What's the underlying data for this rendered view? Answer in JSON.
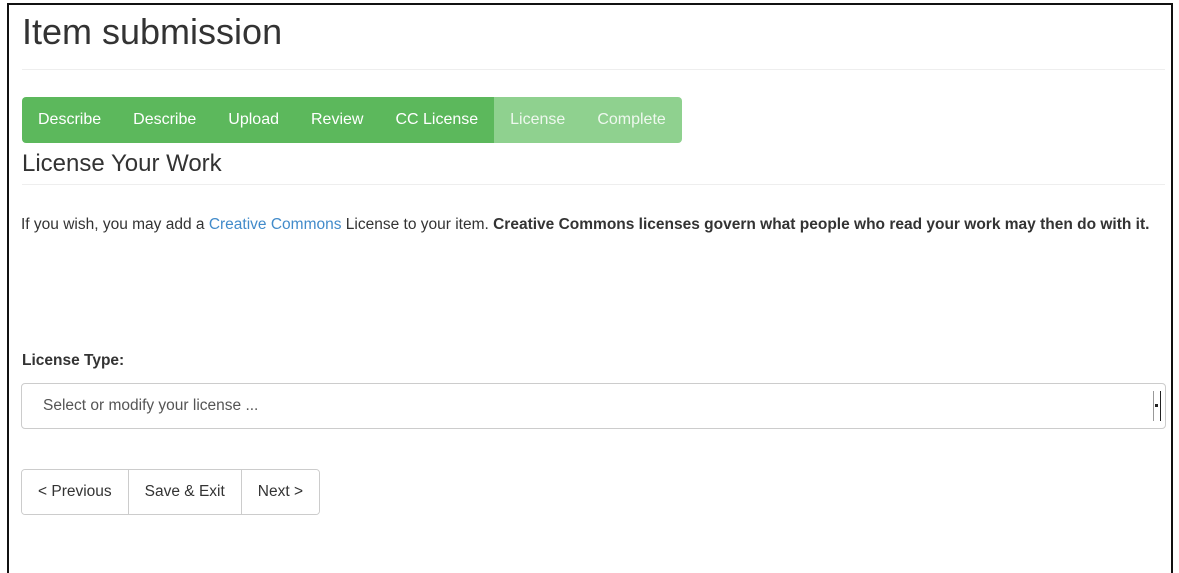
{
  "page": {
    "title": "Item submission"
  },
  "progress": {
    "steps": [
      {
        "label": "Describe",
        "state": "done"
      },
      {
        "label": "Describe",
        "state": "done"
      },
      {
        "label": "Upload",
        "state": "done"
      },
      {
        "label": "Review",
        "state": "done"
      },
      {
        "label": "CC License",
        "state": "current"
      },
      {
        "label": "License",
        "state": "upcoming"
      },
      {
        "label": "Complete",
        "state": "upcoming"
      }
    ]
  },
  "section": {
    "title": "License Your Work"
  },
  "intro": {
    "prefix": "If you wish, you may add a ",
    "link_text": "Creative Commons",
    "middle": " License to your item. ",
    "bold_text": "Creative Commons licenses govern what people who read your work may then do with it."
  },
  "license_type": {
    "label": "License Type:",
    "selected_value": "Select or modify your license ..."
  },
  "actions": {
    "previous_label": "< Previous",
    "save_exit_label": "Save & Exit",
    "next_label": "Next >"
  },
  "colors": {
    "step_done": "#5cb85c",
    "step_upcoming": "#8fd18f",
    "link": "#428bca"
  }
}
